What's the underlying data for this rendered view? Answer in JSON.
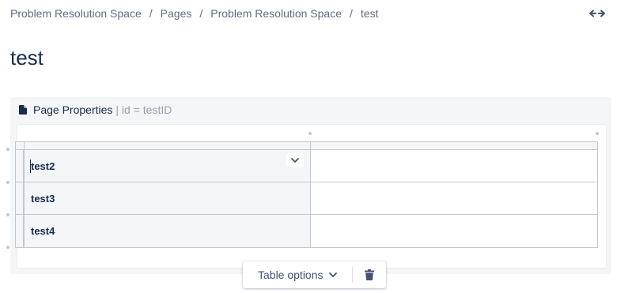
{
  "breadcrumb": {
    "items": [
      "Problem Resolution Space",
      "Pages",
      "Problem Resolution Space",
      "test"
    ],
    "separator": "/"
  },
  "header": {
    "expand_icon": "expand-width-icon"
  },
  "page": {
    "title": "test"
  },
  "macro": {
    "icon": "document-icon",
    "name": "Page Properties",
    "params": "| id = testID",
    "table": {
      "rows": [
        {
          "key": "test2",
          "value": ""
        },
        {
          "key": "test3",
          "value": ""
        },
        {
          "key": "test4",
          "value": ""
        }
      ],
      "cell_menu_icon": "chevron-down-icon"
    }
  },
  "toolbar": {
    "table_options_label": "Table options",
    "delete_icon": "trash-icon"
  },
  "colors": {
    "text": "#172b4d",
    "muted": "#5e6c84",
    "macro_bg": "#f4f5f7",
    "border": "#c1c7d0"
  }
}
